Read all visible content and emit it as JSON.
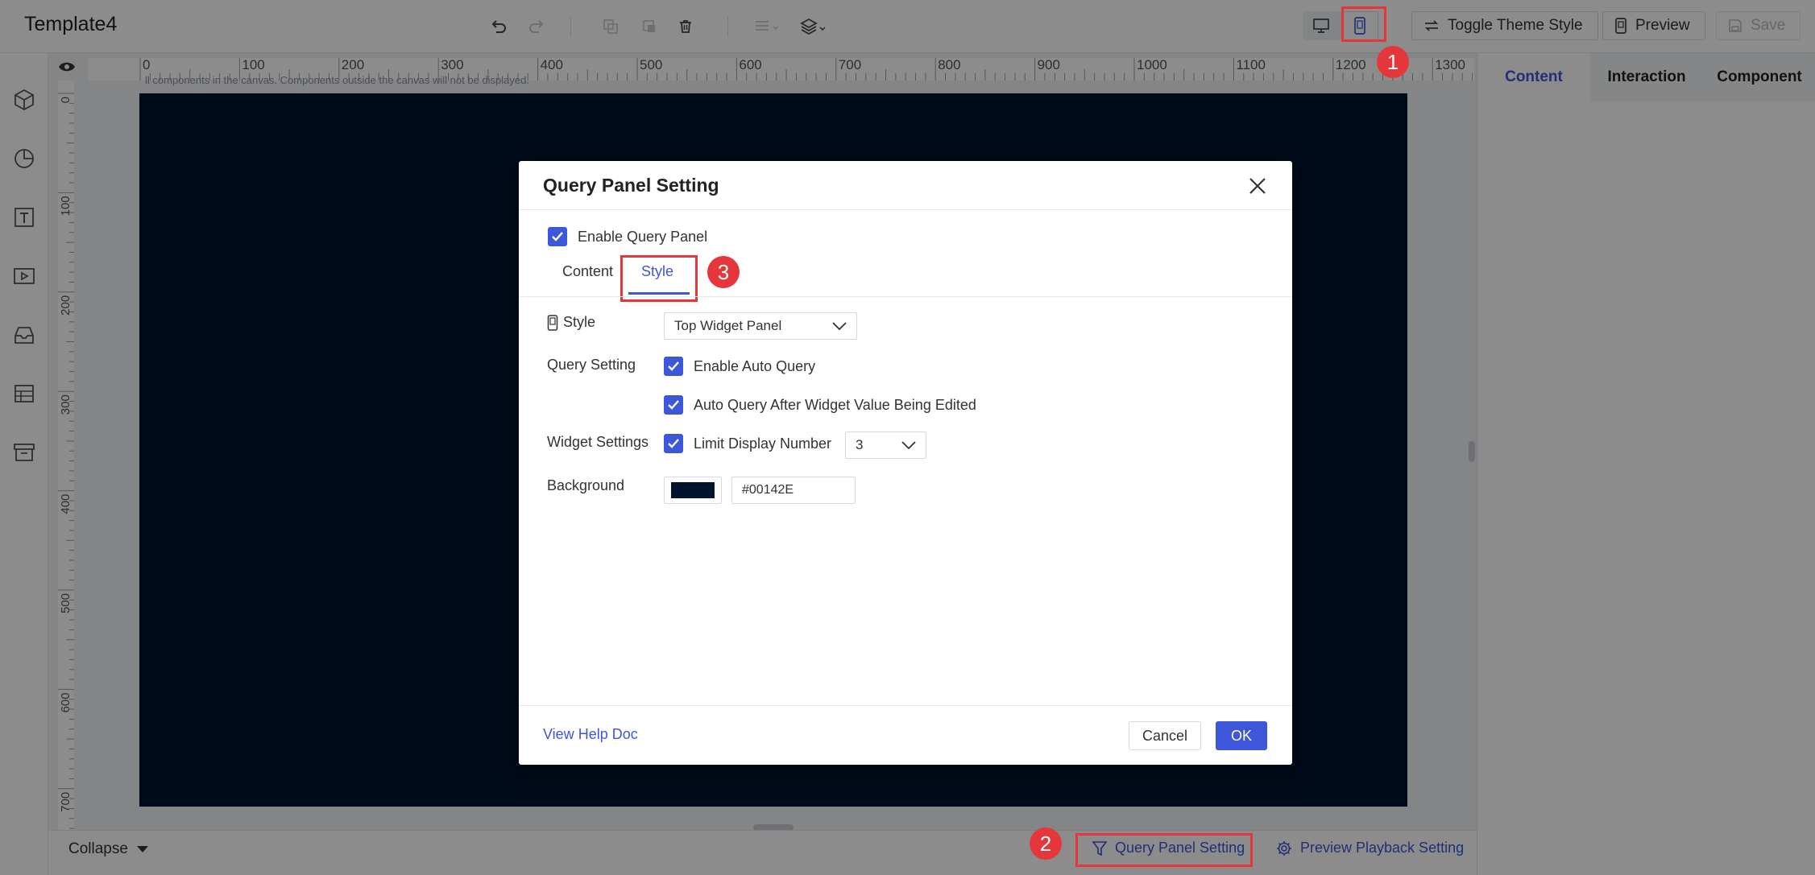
{
  "header": {
    "title": "Template4",
    "toggle_theme_label": "Toggle Theme Style",
    "preview_label": "Preview",
    "save_label": "Save"
  },
  "ruler": {
    "top_ticks": [
      "0",
      "100",
      "200",
      "300",
      "400",
      "500",
      "600",
      "700",
      "800",
      "900",
      "1000",
      "1100",
      "1200",
      "1300"
    ],
    "left_ticks": [
      "0",
      "100",
      "200",
      "300",
      "400",
      "500",
      "600",
      "700"
    ]
  },
  "canvas": {
    "hint": "ll components in the canvas. Components outside the canvas will not be displayed.",
    "background": "#00142E"
  },
  "annotations": {
    "badge1": "1",
    "badge2": "2",
    "badge3": "3"
  },
  "right_panel": {
    "tabs": [
      {
        "label": "Content"
      },
      {
        "label": "Interaction"
      },
      {
        "label": "Component"
      }
    ]
  },
  "bottom": {
    "collapse_label": "Collapse",
    "query_panel_label": "Query Panel Setting",
    "preview_playback_label": "Preview Playback Setting"
  },
  "modal": {
    "title": "Query Panel Setting",
    "enable_label": "Enable Query Panel",
    "tabs": [
      {
        "label": "Content"
      },
      {
        "label": "Style"
      }
    ],
    "style_label": "Style",
    "style_value": "Top Widget Panel",
    "query_setting_label": "Query Setting",
    "auto_query_label": "Enable Auto Query",
    "auto_query_edit_label": "Auto Query After Widget Value Being Edited",
    "widget_settings_label": "Widget Settings",
    "limit_display_label": "Limit Display Number",
    "limit_value": "3",
    "background_label": "Background",
    "background_value": "#00142E",
    "help_link": "View Help Doc",
    "cancel_label": "Cancel",
    "ok_label": "OK"
  },
  "colors": {
    "accent": "#3e56d9",
    "annotation": "#e5373b",
    "canvas_bg": "#00142E"
  }
}
